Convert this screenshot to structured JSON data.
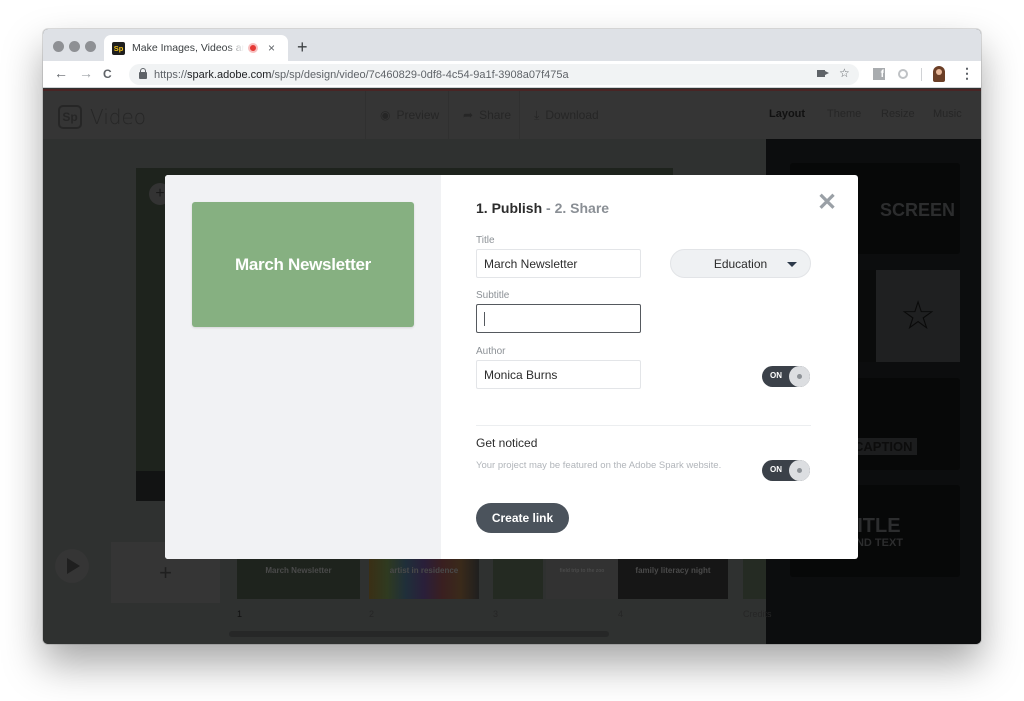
{
  "browser": {
    "tab": {
      "favicon_text": "Sp",
      "title": "Make Images, Videos and Web Stories",
      "recording_indicator": "recording-dot",
      "close_label": "×"
    },
    "new_tab_label": "+",
    "nav": {
      "back": "←",
      "forward": "→",
      "reload": "C"
    },
    "url": {
      "scheme": "https://",
      "host": "spark.adobe.com",
      "path": "/sp/sp/design/video/7c460829-0df8-4c54-9a1f-3908a07f475a"
    },
    "bookmark_icon": "☆",
    "menu_icon": "⋮",
    "extension_fb_label": "f"
  },
  "app": {
    "logo_mark": "Sp",
    "logo_text": "Video",
    "header_buttons": [
      {
        "icon": "◉",
        "label": "Preview"
      },
      {
        "icon": "➦",
        "label": "Share"
      },
      {
        "icon": "⤓",
        "label": "Download"
      }
    ],
    "right_tabs": [
      {
        "label": "Layout",
        "active": true
      },
      {
        "label": "Theme",
        "active": false
      },
      {
        "label": "Resize",
        "active": false
      },
      {
        "label": "Music",
        "active": false
      }
    ],
    "layout_cards": [
      {
        "label": "SCREEN",
        "sub": ""
      },
      {
        "label": "☆",
        "sub": ""
      },
      {
        "label": "CAPTION",
        "sub": ""
      },
      {
        "label": "TITLE",
        "sub": "AND TEXT"
      }
    ],
    "stage_plus": "+",
    "timeline": {
      "add_label": "+",
      "slides": [
        {
          "num": "1",
          "text": "March Newsletter"
        },
        {
          "num": "2",
          "text": "artist in residence"
        },
        {
          "num": "3",
          "text": "field trip to the zoo"
        },
        {
          "num": "4",
          "text": "family literacy night"
        },
        {
          "num": "Credits",
          "text": ""
        }
      ]
    }
  },
  "modal": {
    "preview_title": "March Newsletter",
    "steps": {
      "step1": "1. Publish",
      "separator": " - ",
      "step2": "2. Share"
    },
    "close_label": "✕",
    "title_label": "Title",
    "title_value": "March Newsletter",
    "category_selected": "Education",
    "subtitle_label": "Subtitle",
    "subtitle_value": "",
    "author_label": "Author",
    "author_value": "Monica Burns",
    "author_toggle": {
      "label": "ON",
      "on": true
    },
    "get_noticed_title": "Get noticed",
    "get_noticed_desc": "Your project may be featured on the Adobe Spark website.",
    "get_noticed_toggle": {
      "label": "ON",
      "on": true
    },
    "create_link_label": "Create link"
  },
  "colors": {
    "preview_green": "#86b081",
    "button_dark": "#4b535c",
    "toggle_dark": "#3b4149"
  }
}
